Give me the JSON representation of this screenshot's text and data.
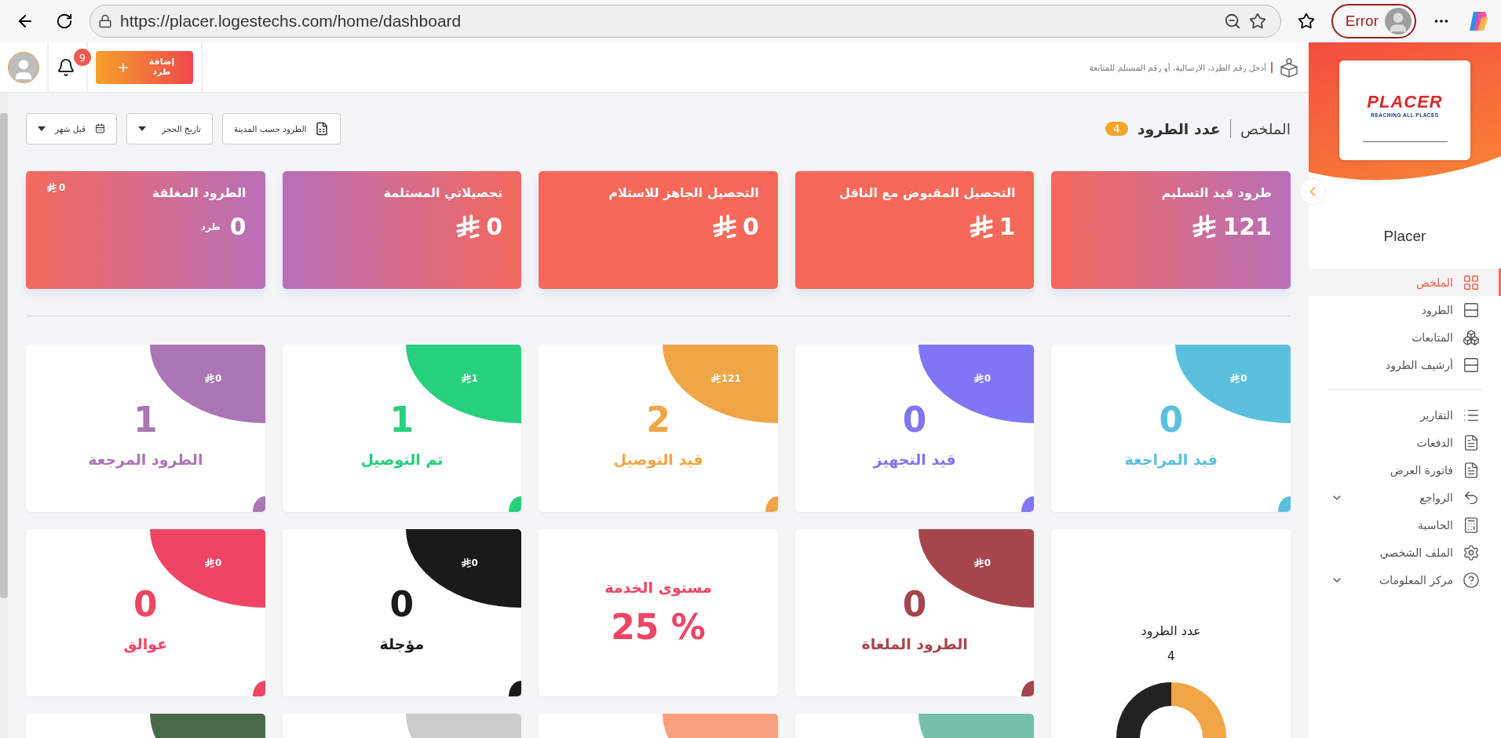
{
  "browser": {
    "url": "https://placer.logestechs.com/home/dashboard",
    "profile_status": "Error"
  },
  "header": {
    "add_button": "إضافة طرد",
    "notifications": "9",
    "search_placeholder": "أدخل رقم الطرد، الارسالية، أو رقم المستلم للمتابعة"
  },
  "sidebar": {
    "logo_text": "PLACER",
    "logo_tagline": "REACHING ALL PLACES",
    "brand": "Placer",
    "sections": [
      {
        "items": [
          {
            "label": "الملخص",
            "kind": "grid",
            "selected": true,
            "expandable": false
          },
          {
            "label": "الطرود",
            "kind": "rows",
            "selected": false,
            "expandable": false
          },
          {
            "label": "المتابعات",
            "kind": "boxes",
            "selected": false,
            "expandable": false
          },
          {
            "label": "أرشيف الطرود",
            "kind": "rows",
            "selected": false,
            "expandable": false
          }
        ]
      },
      {
        "items": [
          {
            "label": "التقارير",
            "kind": "list",
            "selected": false,
            "expandable": false
          },
          {
            "label": "الدفعات",
            "kind": "file",
            "selected": false,
            "expandable": false
          },
          {
            "label": "فاتورة العرض",
            "kind": "file",
            "selected": false,
            "expandable": false
          },
          {
            "label": "الرواجع",
            "kind": "return",
            "selected": false,
            "expandable": true
          },
          {
            "label": "الحاسبة",
            "kind": "calculator",
            "selected": false,
            "expandable": false
          },
          {
            "label": "الملف الشخصي",
            "kind": "settings",
            "selected": false,
            "expandable": false
          },
          {
            "label": "مركز المعلومات",
            "kind": "help",
            "selected": false,
            "expandable": true
          }
        ]
      }
    ]
  },
  "title": {
    "main": "الملخص",
    "sub": "عدد الطرود",
    "count": "4"
  },
  "filters": {
    "export_button": "الطرود حسب المدينة",
    "date_type": "تاريخ الحجز",
    "period": "قبل شهر"
  },
  "summary_cards": [
    {
      "kind": "gradient",
      "title": "طرود قيد التسليم",
      "value": "121"
    },
    {
      "kind": "solid",
      "title": "التحصيل المقبوض مع الناقل",
      "value": "1"
    },
    {
      "kind": "solid",
      "title": "التحصيل الجاهز للاستلام",
      "value": "0"
    },
    {
      "kind": "reverse",
      "title": "تحصيلاتي المستلمة",
      "value": "0"
    },
    {
      "kind": "gradient",
      "title": "الطرود المغلقة",
      "value": "0",
      "unit": "طرد",
      "amount": "0"
    }
  ],
  "status_cards": [
    {
      "kind": "status",
      "label": "قيد المراجعة",
      "count": "0",
      "amount": "0",
      "color": "#5bc0de"
    },
    {
      "kind": "status",
      "label": "قيد التجهيز",
      "count": "0",
      "amount": "0",
      "color": "#8076f5"
    },
    {
      "kind": "status",
      "label": "قيد التوصيل",
      "count": "2",
      "amount": "121",
      "color": "#f0a646"
    },
    {
      "kind": "status",
      "label": "تم التوصيل",
      "count": "1",
      "amount": "1",
      "color": "#26d07c"
    },
    {
      "kind": "status",
      "label": "الطرود المرجعة",
      "count": "1",
      "amount": "0",
      "color": "#ab76b4"
    },
    {
      "kind": "chart",
      "title": "عدد الطرود",
      "count": "4"
    },
    {
      "kind": "status",
      "label": "الطرود الملغاة",
      "count": "0",
      "amount": "0",
      "color": "#a6464c"
    },
    {
      "kind": "percent",
      "label": "مستوى الخدمة",
      "count": "25 %",
      "color": "#ef4565"
    },
    {
      "kind": "status",
      "label": "مؤجلة",
      "count": "0",
      "amount": "0",
      "color": "#1a1a1a"
    },
    {
      "kind": "status",
      "label": "عوالق",
      "count": "0",
      "amount": "0",
      "color": "#ef4565"
    },
    {
      "kind": "partial",
      "color": "#76bfa8"
    },
    {
      "kind": "partial",
      "color": "#f9a07e"
    },
    {
      "kind": "partial",
      "color": "#cccccc"
    },
    {
      "kind": "partial",
      "color": "#4a6b48"
    }
  ]
}
